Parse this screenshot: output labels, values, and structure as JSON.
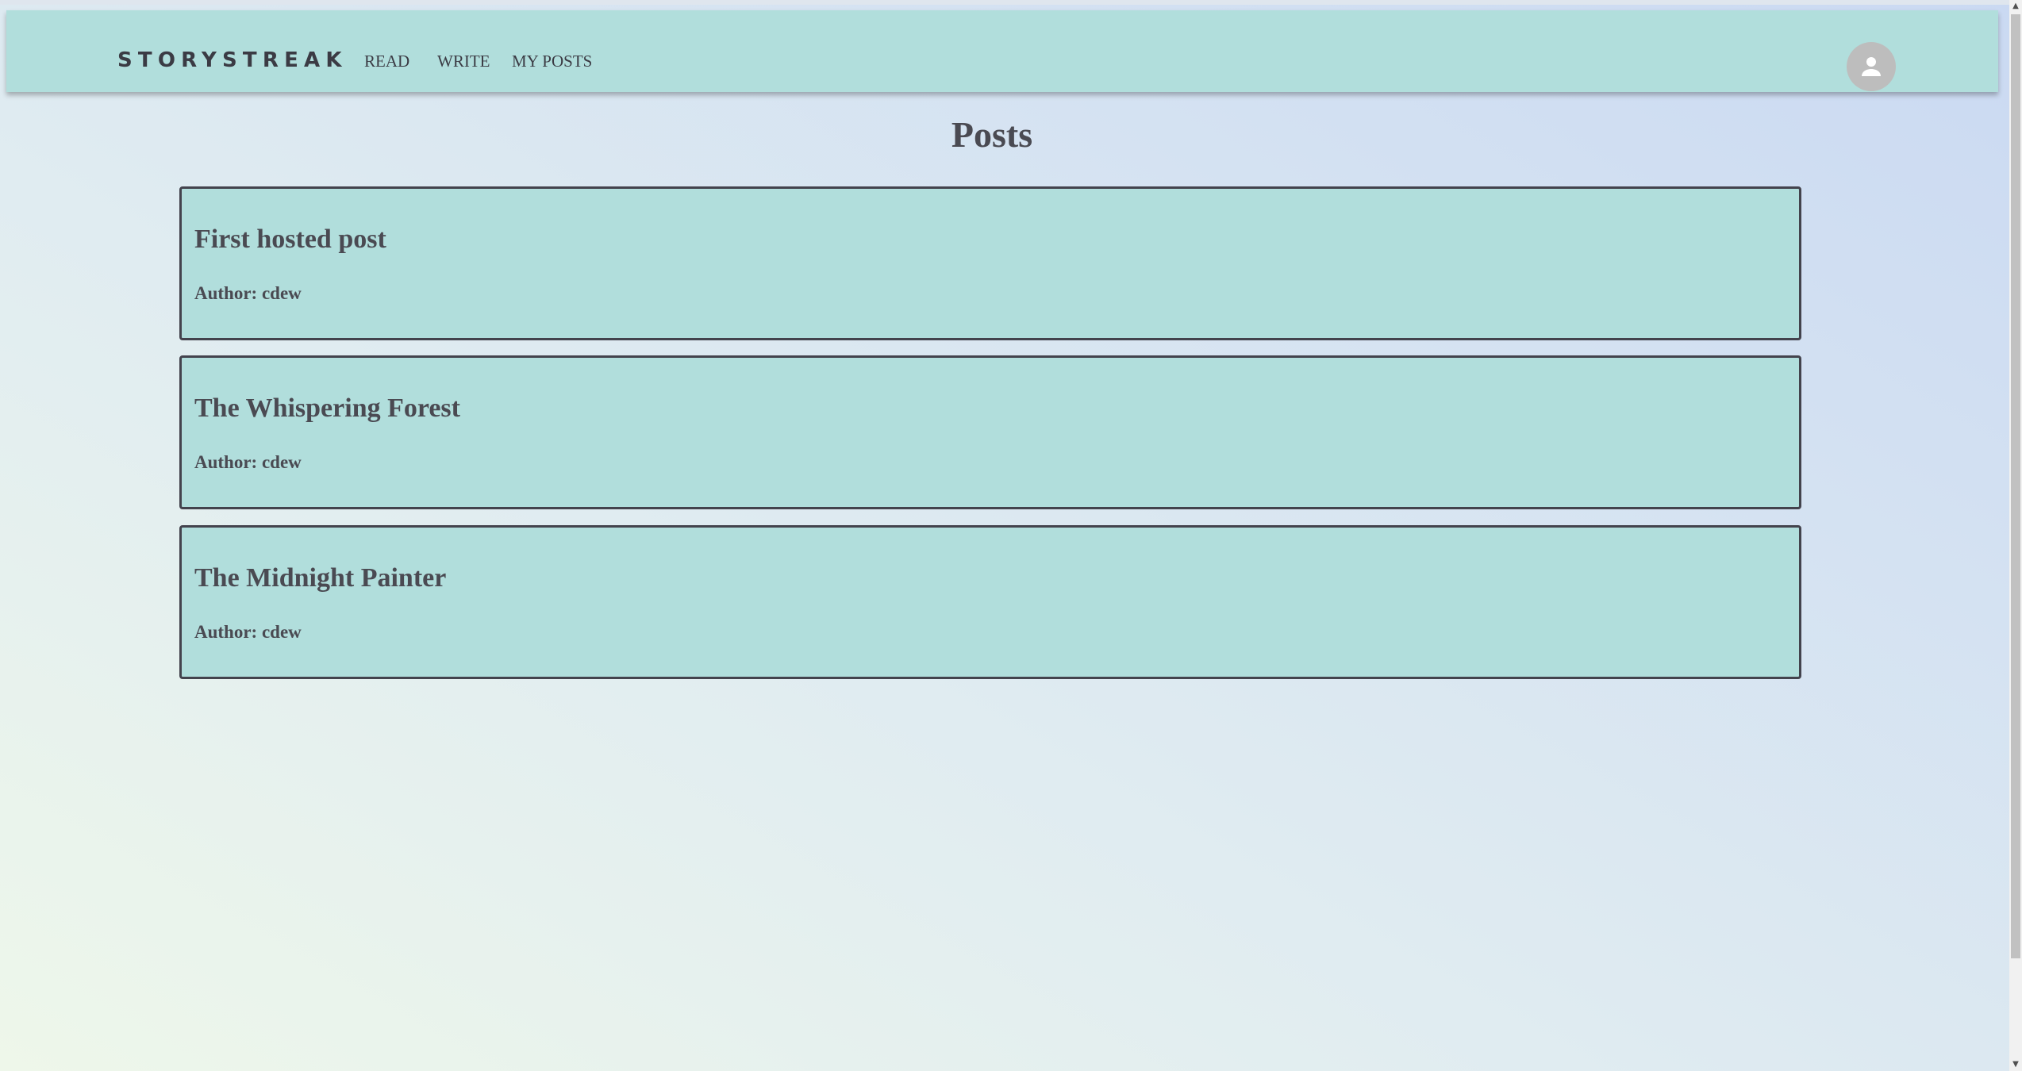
{
  "nav": {
    "brand": "STORYSTREAK",
    "links": [
      {
        "label": "READ"
      },
      {
        "label": "WRITE"
      },
      {
        "label": "MY POSTS"
      }
    ],
    "avatar_icon": "person-icon"
  },
  "main": {
    "title": "Posts",
    "posts": [
      {
        "title": "First hosted post",
        "author": "Author: cdew"
      },
      {
        "title": "The Whispering Forest",
        "author": "Author: cdew"
      },
      {
        "title": "The Midnight Painter",
        "author": "Author: cdew"
      }
    ]
  },
  "colors": {
    "navbar": "#b1dedc",
    "card": "#b1dedc",
    "card_border": "#43434d",
    "text": "#4a4a52",
    "avatar_bg": "#bdbdbd"
  }
}
